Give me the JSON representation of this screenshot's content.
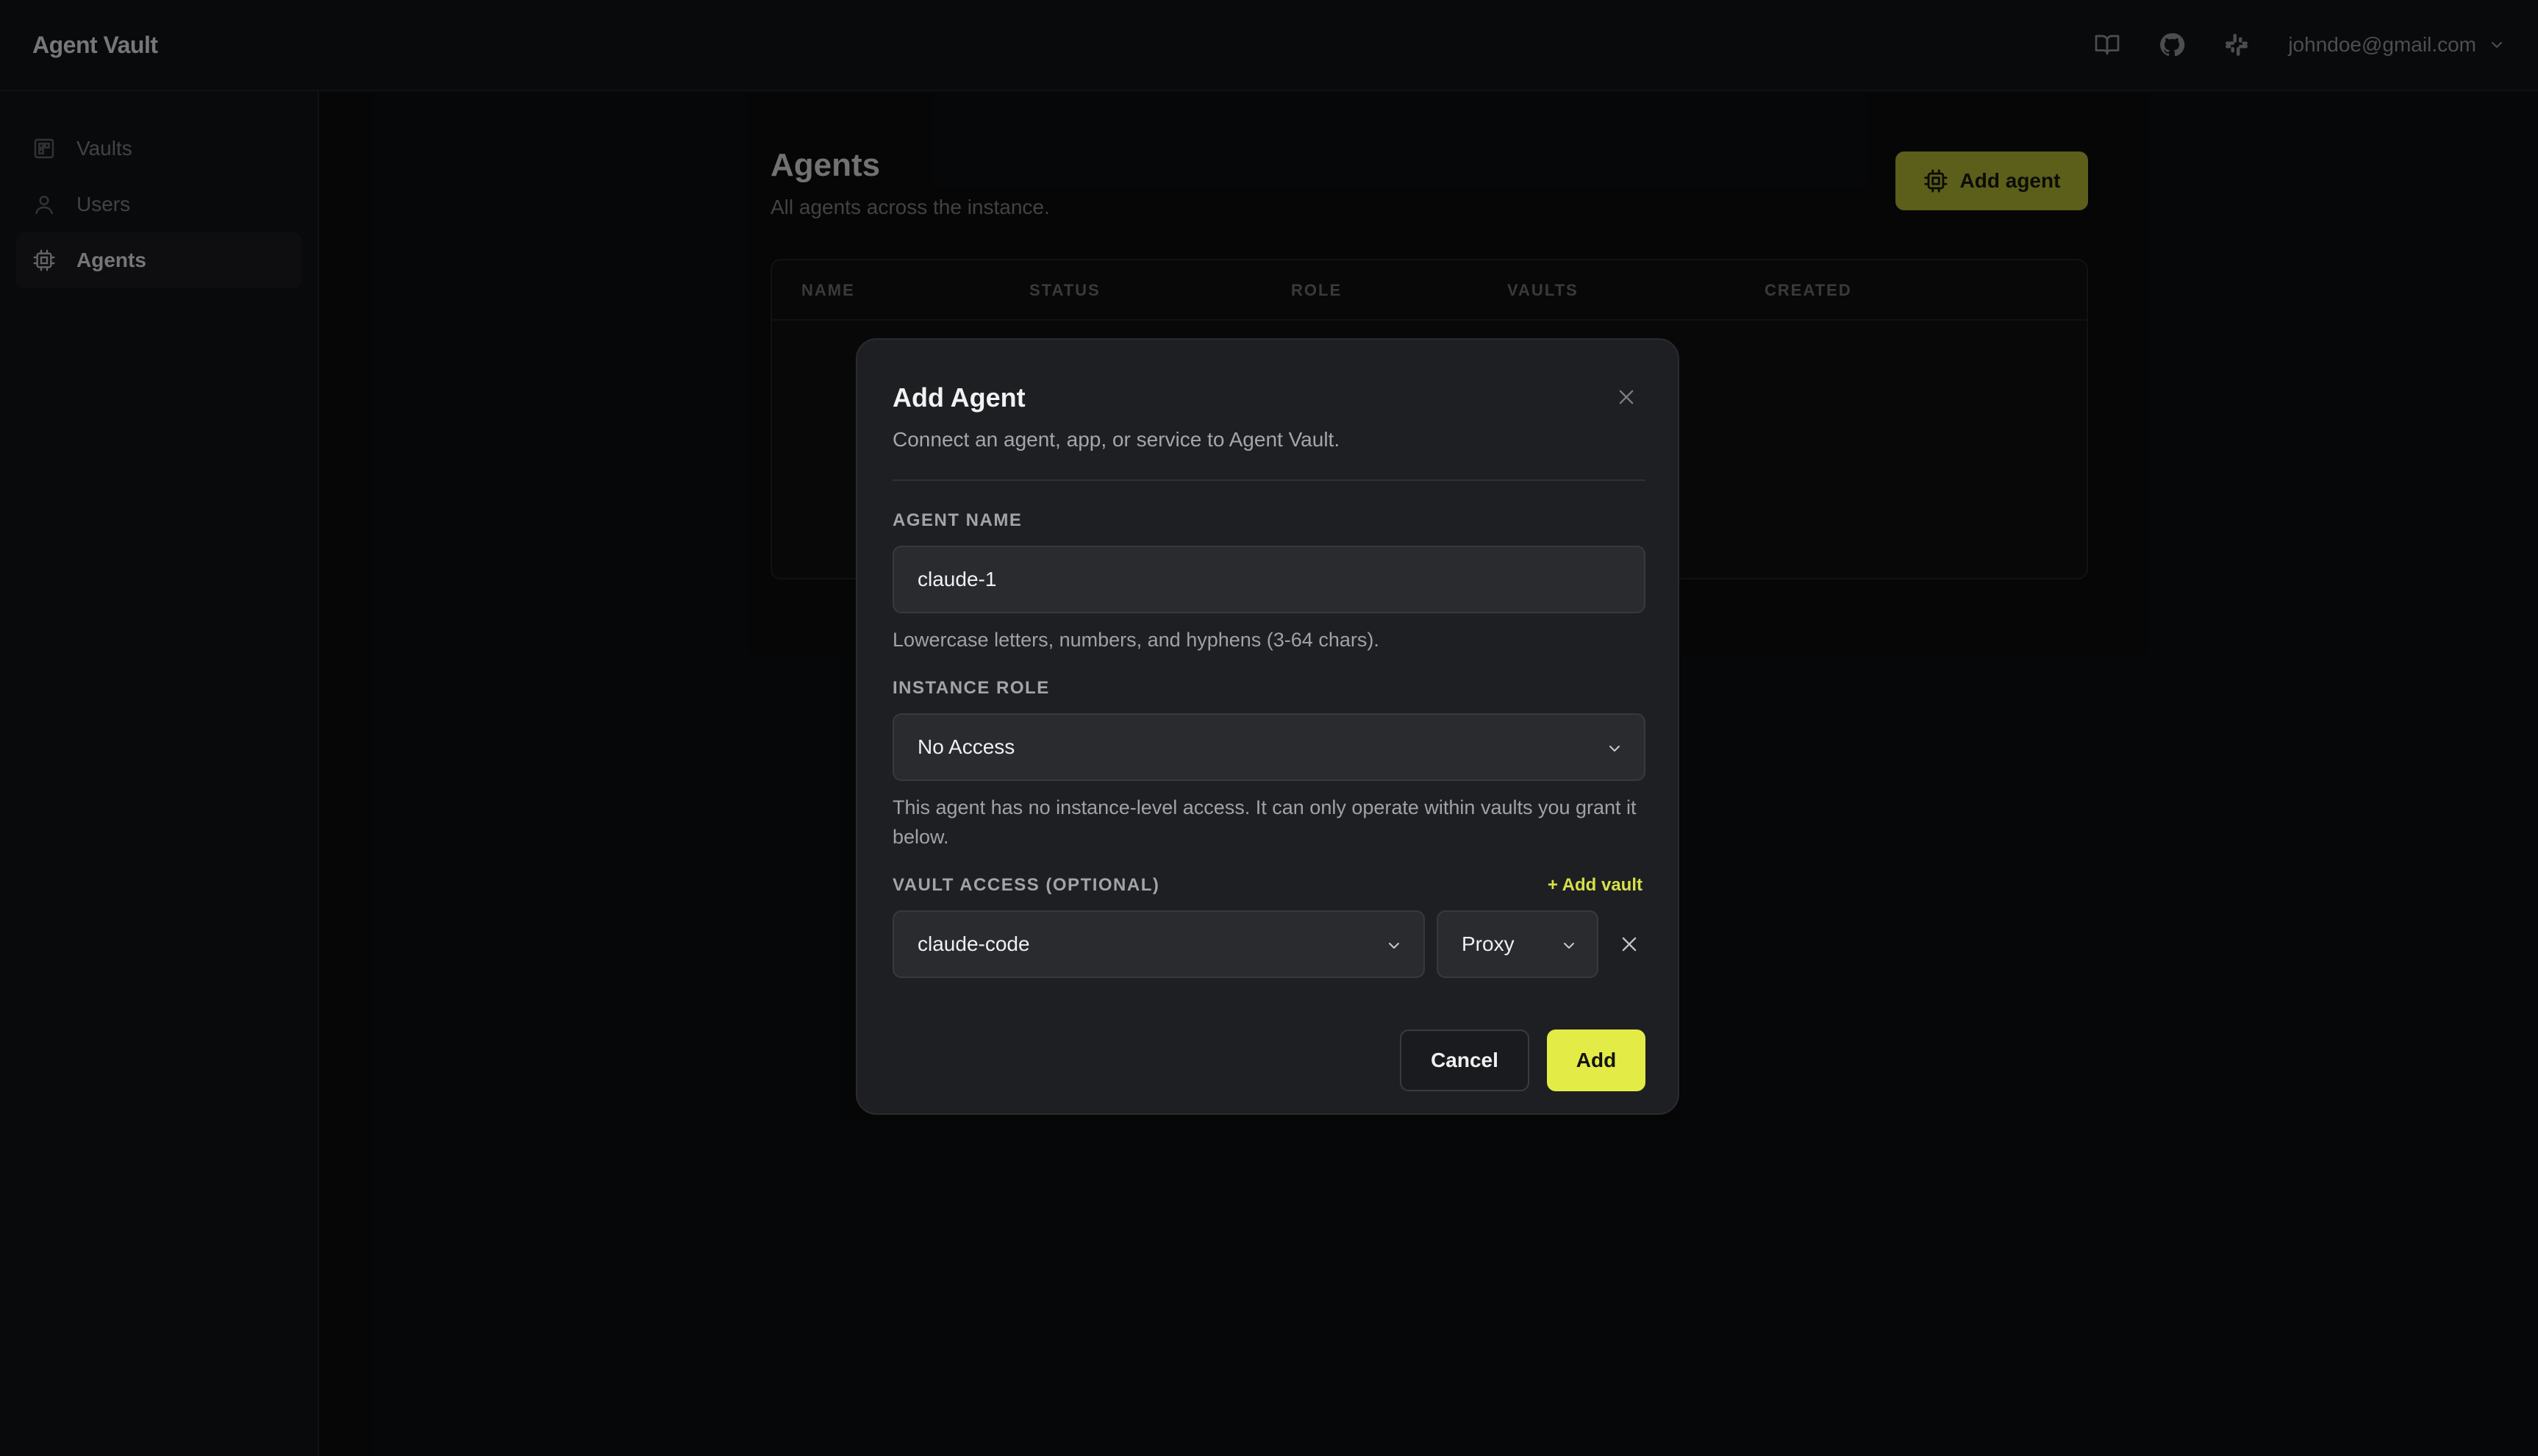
{
  "app": {
    "title": "Agent Vault"
  },
  "header": {
    "user_email": "johndoe@gmail.com",
    "icons": [
      "book-icon",
      "github-icon",
      "slack-icon",
      "chevron-down-icon"
    ]
  },
  "sidebar": {
    "items": [
      {
        "label": "Vaults",
        "icon": "vault-icon",
        "active": false
      },
      {
        "label": "Users",
        "icon": "user-icon",
        "active": false
      },
      {
        "label": "Agents",
        "icon": "cpu-icon",
        "active": true
      }
    ]
  },
  "page": {
    "title": "Agents",
    "subtitle": "All agents across the instance.",
    "add_button_label": "Add agent",
    "table": {
      "columns": [
        "NAME",
        "STATUS",
        "ROLE",
        "VAULTS",
        "CREATED"
      ]
    }
  },
  "modal": {
    "title": "Add Agent",
    "subtitle": "Connect an agent, app, or service to Agent Vault.",
    "agent_name": {
      "label": "AGENT NAME",
      "value": "claude-1",
      "hint": "Lowercase letters, numbers, and hyphens (3-64 chars)."
    },
    "instance_role": {
      "label": "INSTANCE ROLE",
      "selected": "No Access",
      "hint": "This agent has no instance-level access. It can only operate within vaults you grant it below."
    },
    "vault_access": {
      "label": "VAULT ACCESS (OPTIONAL)",
      "add_link": "+ Add vault",
      "rows": [
        {
          "vault": "claude-code",
          "permission": "Proxy"
        }
      ]
    },
    "cancel_label": "Cancel",
    "submit_label": "Add"
  },
  "colors": {
    "accent": "#e3eb47",
    "accent_dim": "#a6ad2e",
    "background": "#0b0c0e",
    "modal_bg": "#1e1f22"
  }
}
